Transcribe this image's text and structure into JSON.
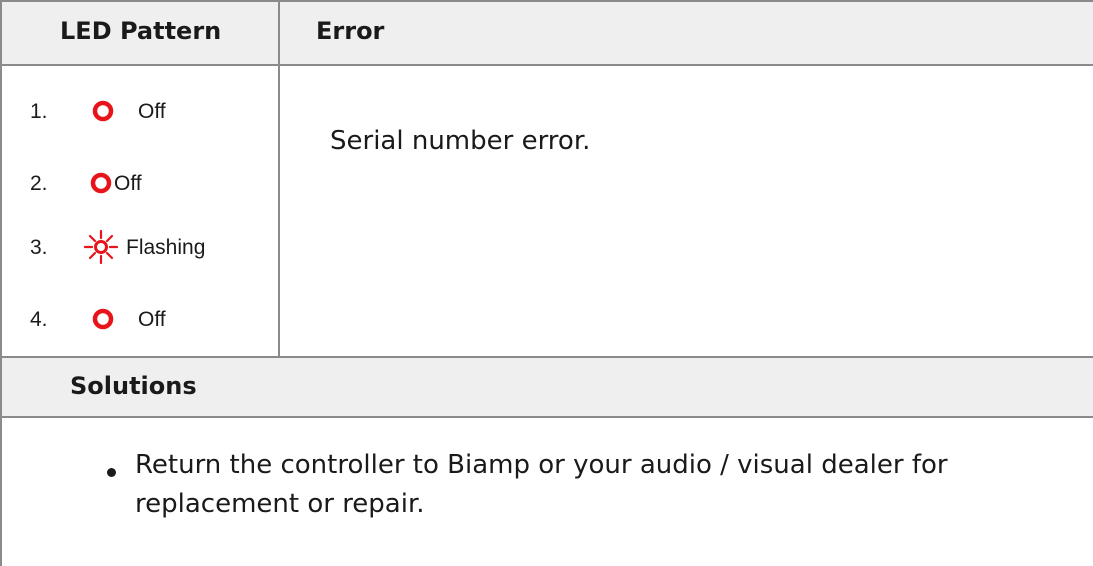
{
  "header": {
    "led_pattern": "LED Pattern",
    "error": "Error"
  },
  "led_pattern": [
    {
      "number": "1.",
      "state": "Off",
      "icon": "red-ring-icon"
    },
    {
      "number": "2.",
      "state": "Off",
      "icon": "red-ring-icon"
    },
    {
      "number": "3.",
      "state": "Flashing",
      "icon": "red-flashing-icon"
    },
    {
      "number": "4.",
      "state": "Off",
      "icon": "red-ring-icon"
    }
  ],
  "error": {
    "text": "Serial number error."
  },
  "solutions": {
    "heading": "Solutions",
    "items": [
      "Return the controller to Biamp or your audio / visual dealer for replacement or repair."
    ]
  },
  "colors": {
    "led_red": "#e8141b",
    "header_bg": "#efefef",
    "border": "#8a8a8a"
  }
}
